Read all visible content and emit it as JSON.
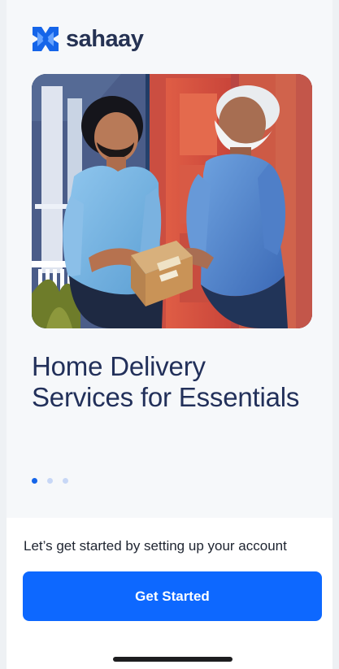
{
  "brand": {
    "name": "sahaay",
    "logo_icon": "sahaay-logo-icon",
    "colors": {
      "primary": "#1565e9",
      "secondary": "#66a3ff",
      "text": "#253253"
    }
  },
  "hero": {
    "image": "delivery-person-handing-package-to-elderly-man"
  },
  "onboarding": {
    "title": "Home Delivery Services for Essentials",
    "slide_index": 1,
    "slide_count": 3
  },
  "footer": {
    "message": "Let’s get started by setting up your account",
    "button_label": "Get Started",
    "button_color": "#0d68ff"
  },
  "system": {
    "home_indicator": "home-indicator"
  }
}
